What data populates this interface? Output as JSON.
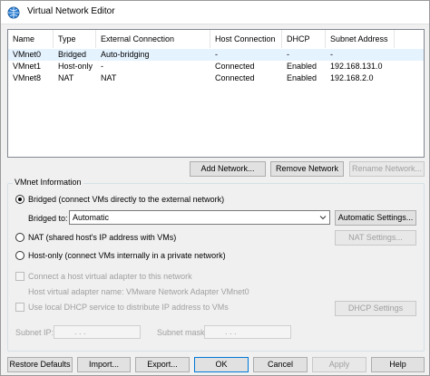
{
  "window": {
    "title": "Virtual Network Editor",
    "icon": "network-globe-icon"
  },
  "table": {
    "columns": [
      "Name",
      "Type",
      "External Connection",
      "Host Connection",
      "DHCP",
      "Subnet Address"
    ],
    "rows": [
      {
        "name": "VMnet0",
        "type": "Bridged",
        "external": "Auto-bridging",
        "host": "-",
        "dhcp": "-",
        "subnet": "-",
        "selected": true
      },
      {
        "name": "VMnet1",
        "type": "Host-only",
        "external": "-",
        "host": "Connected",
        "dhcp": "Enabled",
        "subnet": "192.168.131.0",
        "selected": false
      },
      {
        "name": "VMnet8",
        "type": "NAT",
        "external": "NAT",
        "host": "Connected",
        "dhcp": "Enabled",
        "subnet": "192.168.2.0",
        "selected": false
      }
    ]
  },
  "network_buttons": {
    "add": "Add Network...",
    "remove": "Remove Network",
    "rename": "Rename Network..."
  },
  "vmnet_info": {
    "title": "VMnet Information",
    "bridged_label": "Bridged (connect VMs directly to the external network)",
    "bridged_to_label": "Bridged to:",
    "bridged_to_value": "Automatic",
    "auto_settings": "Automatic Settings...",
    "nat_label": "NAT (shared host's IP address with VMs)",
    "nat_settings": "NAT Settings...",
    "hostonly_label": "Host-only (connect VMs internally in a private network)",
    "connect_adapter_label": "Connect a host virtual adapter to this network",
    "adapter_name_label": "Host virtual adapter name: VMware Network Adapter VMnet0",
    "dhcp_label": "Use local DHCP service to distribute IP address to VMs",
    "dhcp_settings": "DHCP Settings",
    "subnet_ip_label": "Subnet IP:",
    "subnet_mask_label": "Subnet mask:",
    "ip_dots": ".        .        .",
    "mask_dots": ".        .        ."
  },
  "footer": {
    "restore": "Restore Defaults",
    "import": "Import...",
    "export": "Export...",
    "ok": "OK",
    "cancel": "Cancel",
    "apply": "Apply",
    "help": "Help"
  },
  "colors": {
    "accent": "#0078d7",
    "selected_row": "#e5f3ff",
    "disabled_text": "#a0a0a0"
  }
}
